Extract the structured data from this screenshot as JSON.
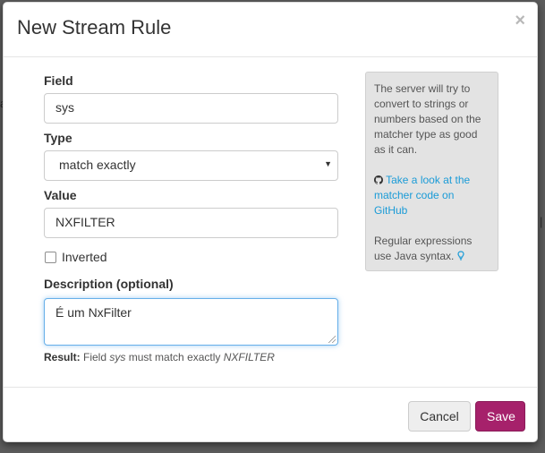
{
  "modal": {
    "title": "New Stream Rule",
    "close_glyph": "×"
  },
  "form": {
    "field": {
      "label": "Field",
      "value": "sys"
    },
    "type": {
      "label": "Type",
      "selected": "match exactly"
    },
    "value": {
      "label": "Value",
      "value": "NXFILTER"
    },
    "inverted": {
      "label": "Inverted",
      "checked": false
    },
    "description": {
      "label": "Description (optional)",
      "value": "É um NxFilter"
    },
    "result": {
      "label": "Result:",
      "prefix": "Field",
      "field": "sys",
      "middle": "must match exactly",
      "value": "NXFILTER"
    }
  },
  "help": {
    "text": "The server will try to convert to strings or numbers based on the matcher type as good as it can.",
    "github_icon": "github-icon",
    "link_text": "Take a look at the matcher code on GitHub",
    "regex_text": "Regular expressions use Java syntax.",
    "lightbulb_icon": "lightbulb-icon"
  },
  "footer": {
    "cancel_label": "Cancel",
    "save_label": "Save"
  },
  "colors": {
    "save_button": "#a6216b",
    "link": "#1a9bd7",
    "focus_border": "#66afe9"
  }
}
